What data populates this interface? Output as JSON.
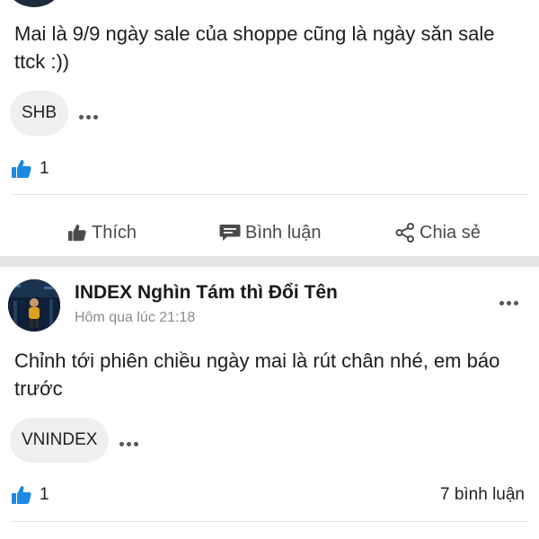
{
  "post1": {
    "text": "Mai là 9/9 ngày sale của shoppe cũng là ngày săn sale ttck :))",
    "tags": [
      "SHB"
    ],
    "like_count": "1"
  },
  "actions": {
    "like": "Thích",
    "comment": "Bình luận",
    "share": "Chia sẻ"
  },
  "post2": {
    "author": "INDEX Nghìn Tám thì Đổi Tên",
    "time": "Hôm qua lúc 21:18",
    "text": "Chỉnh tới phiên chiều ngày mai là rút chân nhé, em báo trước",
    "tags": [
      "VNINDEX"
    ],
    "like_count": "1",
    "comment_count": "7 bình luận"
  },
  "colors": {
    "like_blue": "#1e88e5",
    "divider": "#e6e6e8",
    "band": "#e4e4e6"
  },
  "icons": {
    "like": "thumbs-up-icon",
    "comment": "speech-bubble-icon",
    "share": "share-icon",
    "more": "more-horizontal-icon"
  }
}
